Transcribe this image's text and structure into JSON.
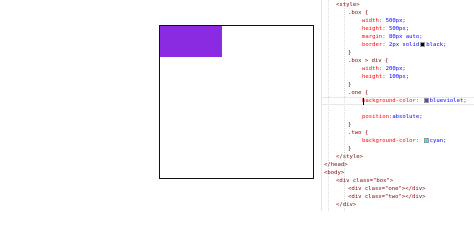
{
  "preview": {
    "box_border_color": "#111111",
    "one_color": "#8a2be2"
  },
  "code": {
    "style_open": "<style>",
    "box_sel": ".box {",
    "box_w_prop": "width:",
    "box_w_val": "500px;",
    "box_h_prop": "height:",
    "box_h_val": "500px;",
    "box_m_prop": "margin:",
    "box_m_val": "80px auto;",
    "box_b_prop": "border:",
    "box_b_val": "2px solid",
    "box_b_color_name": "black;",
    "box_close": "}",
    "boxdiv_sel": ".box > div {",
    "boxdiv_w_prop": "width:",
    "boxdiv_w_val": "200px;",
    "boxdiv_h_prop": "height:",
    "boxdiv_h_val": "100px;",
    "boxdiv_close": "}",
    "one_sel": ".one {",
    "one_bg_prop": "background-color:",
    "one_bg_val": "blueviolet;",
    "one_pos_prop": "position:",
    "one_pos_val": "absolute;",
    "one_close": "}",
    "two_sel": ".two {",
    "two_bg_prop": "background-color:",
    "two_bg_val": "cyan;",
    "two_close": "}",
    "style_close": "</style>",
    "head_close": "</head>",
    "body_open": "<body>",
    "div_box_open": "<div class=\"box\">",
    "div_one": "<div class=\"one\"></div>",
    "div_two": "<div class=\"two\"></div>",
    "div_close": "</div>",
    "body_close": "</body>",
    "html_close": "</html>",
    "swatch_black": "#000000",
    "swatch_blueviolet": "#8a2be2",
    "swatch_cyan": "#00ffff"
  }
}
